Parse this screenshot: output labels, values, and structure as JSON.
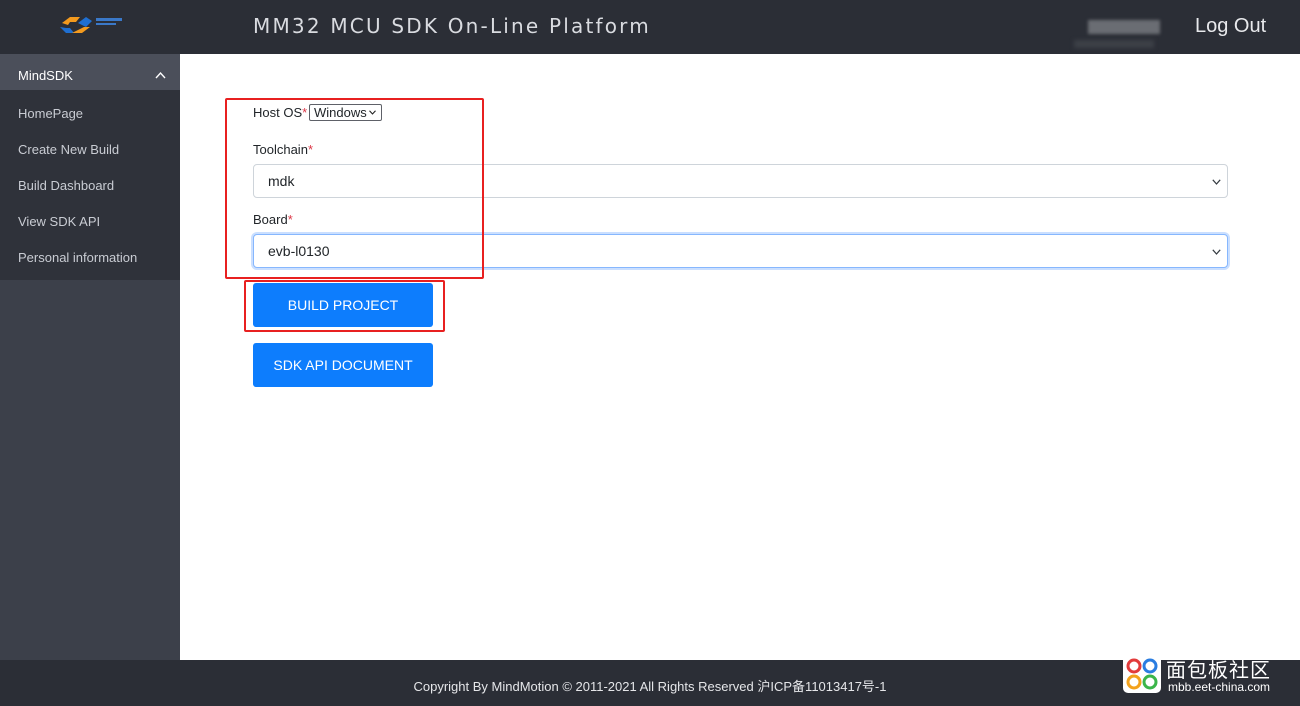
{
  "header": {
    "title": "MM32 MCU SDK On-Line Platform",
    "logout": "Log Out",
    "logo_icon": "mindmotion-logo"
  },
  "sidebar": {
    "group_label": "MindSDK",
    "items": [
      {
        "label": "HomePage"
      },
      {
        "label": "Create New Build"
      },
      {
        "label": "Build Dashboard"
      },
      {
        "label": "View SDK API"
      },
      {
        "label": "Personal information"
      }
    ]
  },
  "form": {
    "host_os": {
      "label": "Host OS",
      "required_mark": "*",
      "value": "Windows"
    },
    "toolchain": {
      "label": "Toolchain",
      "required_mark": "*",
      "value": "mdk"
    },
    "board": {
      "label": "Board",
      "required_mark": "*",
      "value": "evb-l0130"
    }
  },
  "buttons": {
    "build": "BUILD PROJECT",
    "sdk_doc": "SDK API DOCUMENT"
  },
  "footer": {
    "text": "Copyright By MindMotion © 2011-2021 All Rights Reserved 沪ICP备11013417号-1"
  },
  "watermark": {
    "cn": "面包板社区",
    "url": "mbb.eet-china.com"
  },
  "colors": {
    "primary": "#0d7dfd",
    "topbar": "#2b2e36",
    "sidebar": "#3c404a",
    "annotation": "#e82020"
  }
}
